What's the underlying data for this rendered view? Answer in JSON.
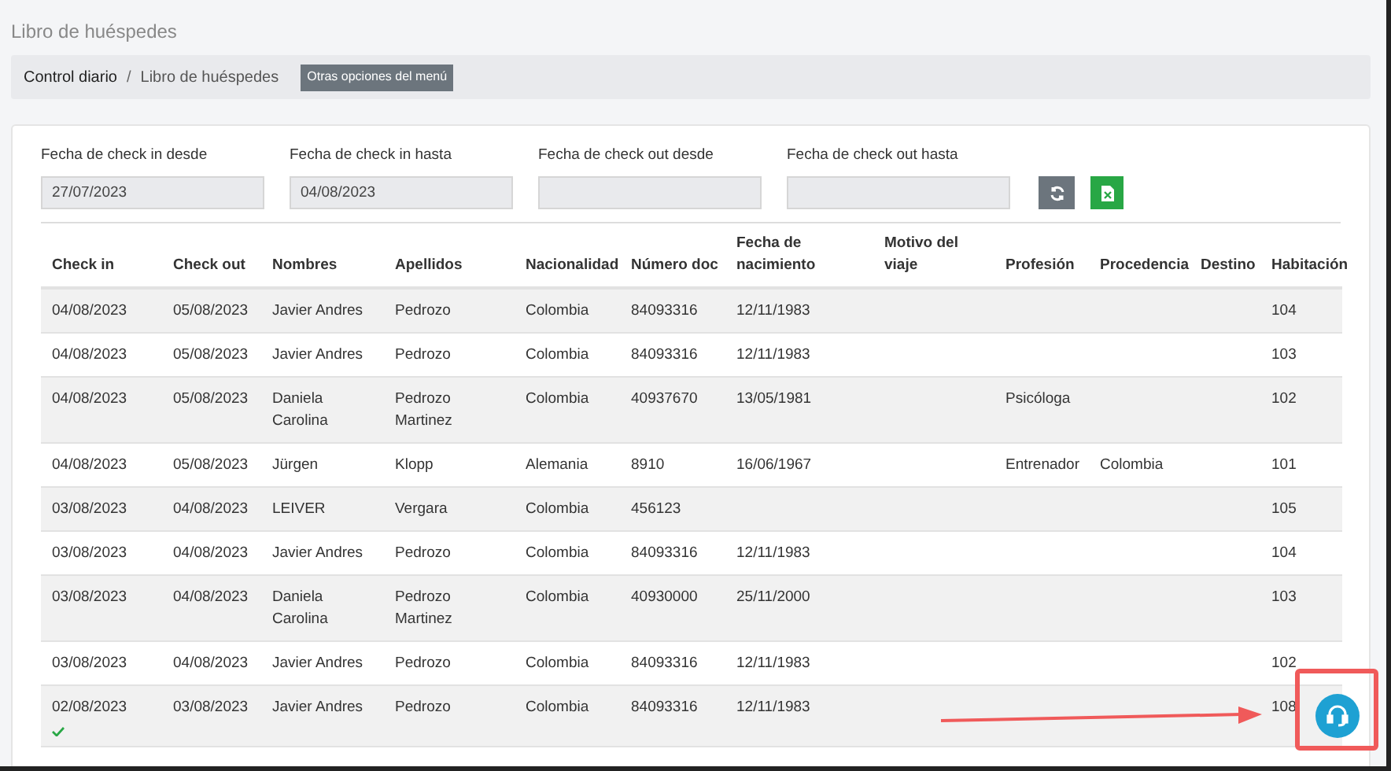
{
  "page_title": "Libro de huéspedes",
  "breadcrumb": {
    "items": [
      "Control diario",
      "Libro de huéspedes"
    ],
    "separator": "/",
    "menu_button": "Otras opciones del menú"
  },
  "filters": [
    {
      "label": "Fecha de check in desde",
      "value": "27/07/2023"
    },
    {
      "label": "Fecha de check in hasta",
      "value": "04/08/2023"
    },
    {
      "label": "Fecha de check out desde"
    },
    {
      "label": "Fecha de check out hasta"
    }
  ],
  "table": {
    "columns": [
      "Check in",
      "Check out",
      "Nombres",
      "Apellidos",
      "Nacionalidad",
      "Número doc",
      "Fecha de nacimiento",
      "Motivo del viaje",
      "Profesión",
      "Procedencia",
      "Destino",
      "Habitación"
    ],
    "rows": [
      {
        "cells": [
          "04/08/2023",
          "05/08/2023",
          "Javier Andres",
          "Pedrozo",
          "Colombia",
          "84093316",
          "12/11/1983",
          "",
          "",
          "",
          "",
          "104"
        ],
        "confirmed": false
      },
      {
        "cells": [
          "04/08/2023",
          "05/08/2023",
          "Javier Andres",
          "Pedrozo",
          "Colombia",
          "84093316",
          "12/11/1983",
          "",
          "",
          "",
          "",
          "103"
        ],
        "confirmed": false
      },
      {
        "cells": [
          "04/08/2023",
          "05/08/2023",
          "Daniela Carolina",
          "Pedrozo Martinez",
          "Colombia",
          "40937670",
          "13/05/1981",
          "",
          "Psicóloga",
          "",
          "",
          "102"
        ],
        "confirmed": false
      },
      {
        "cells": [
          "04/08/2023",
          "05/08/2023",
          "Jürgen",
          "Klopp",
          "Alemania",
          "8910",
          "16/06/1967",
          "",
          "Entrenador",
          "Colombia",
          "",
          "101"
        ],
        "confirmed": false
      },
      {
        "cells": [
          "03/08/2023",
          "04/08/2023",
          "LEIVER",
          "Vergara",
          "Colombia",
          "456123",
          "",
          "",
          "",
          "",
          "",
          "105"
        ],
        "confirmed": false
      },
      {
        "cells": [
          "03/08/2023",
          "04/08/2023",
          "Javier Andres",
          "Pedrozo",
          "Colombia",
          "84093316",
          "12/11/1983",
          "",
          "",
          "",
          "",
          "104"
        ],
        "confirmed": false
      },
      {
        "cells": [
          "03/08/2023",
          "04/08/2023",
          "Daniela Carolina",
          "Pedrozo Martinez",
          "Colombia",
          "40930000",
          "25/11/2000",
          "",
          "",
          "",
          "",
          "103"
        ],
        "confirmed": false
      },
      {
        "cells": [
          "03/08/2023",
          "04/08/2023",
          "Javier Andres",
          "Pedrozo",
          "Colombia",
          "84093316",
          "12/11/1983",
          "",
          "",
          "",
          "",
          "102"
        ],
        "confirmed": false
      },
      {
        "cells": [
          "02/08/2023",
          "03/08/2023",
          "Javier Andres",
          "Pedrozo",
          "Colombia",
          "84093316",
          "12/11/1983",
          "",
          "",
          "",
          "",
          "108"
        ],
        "confirmed": true
      }
    ]
  }
}
